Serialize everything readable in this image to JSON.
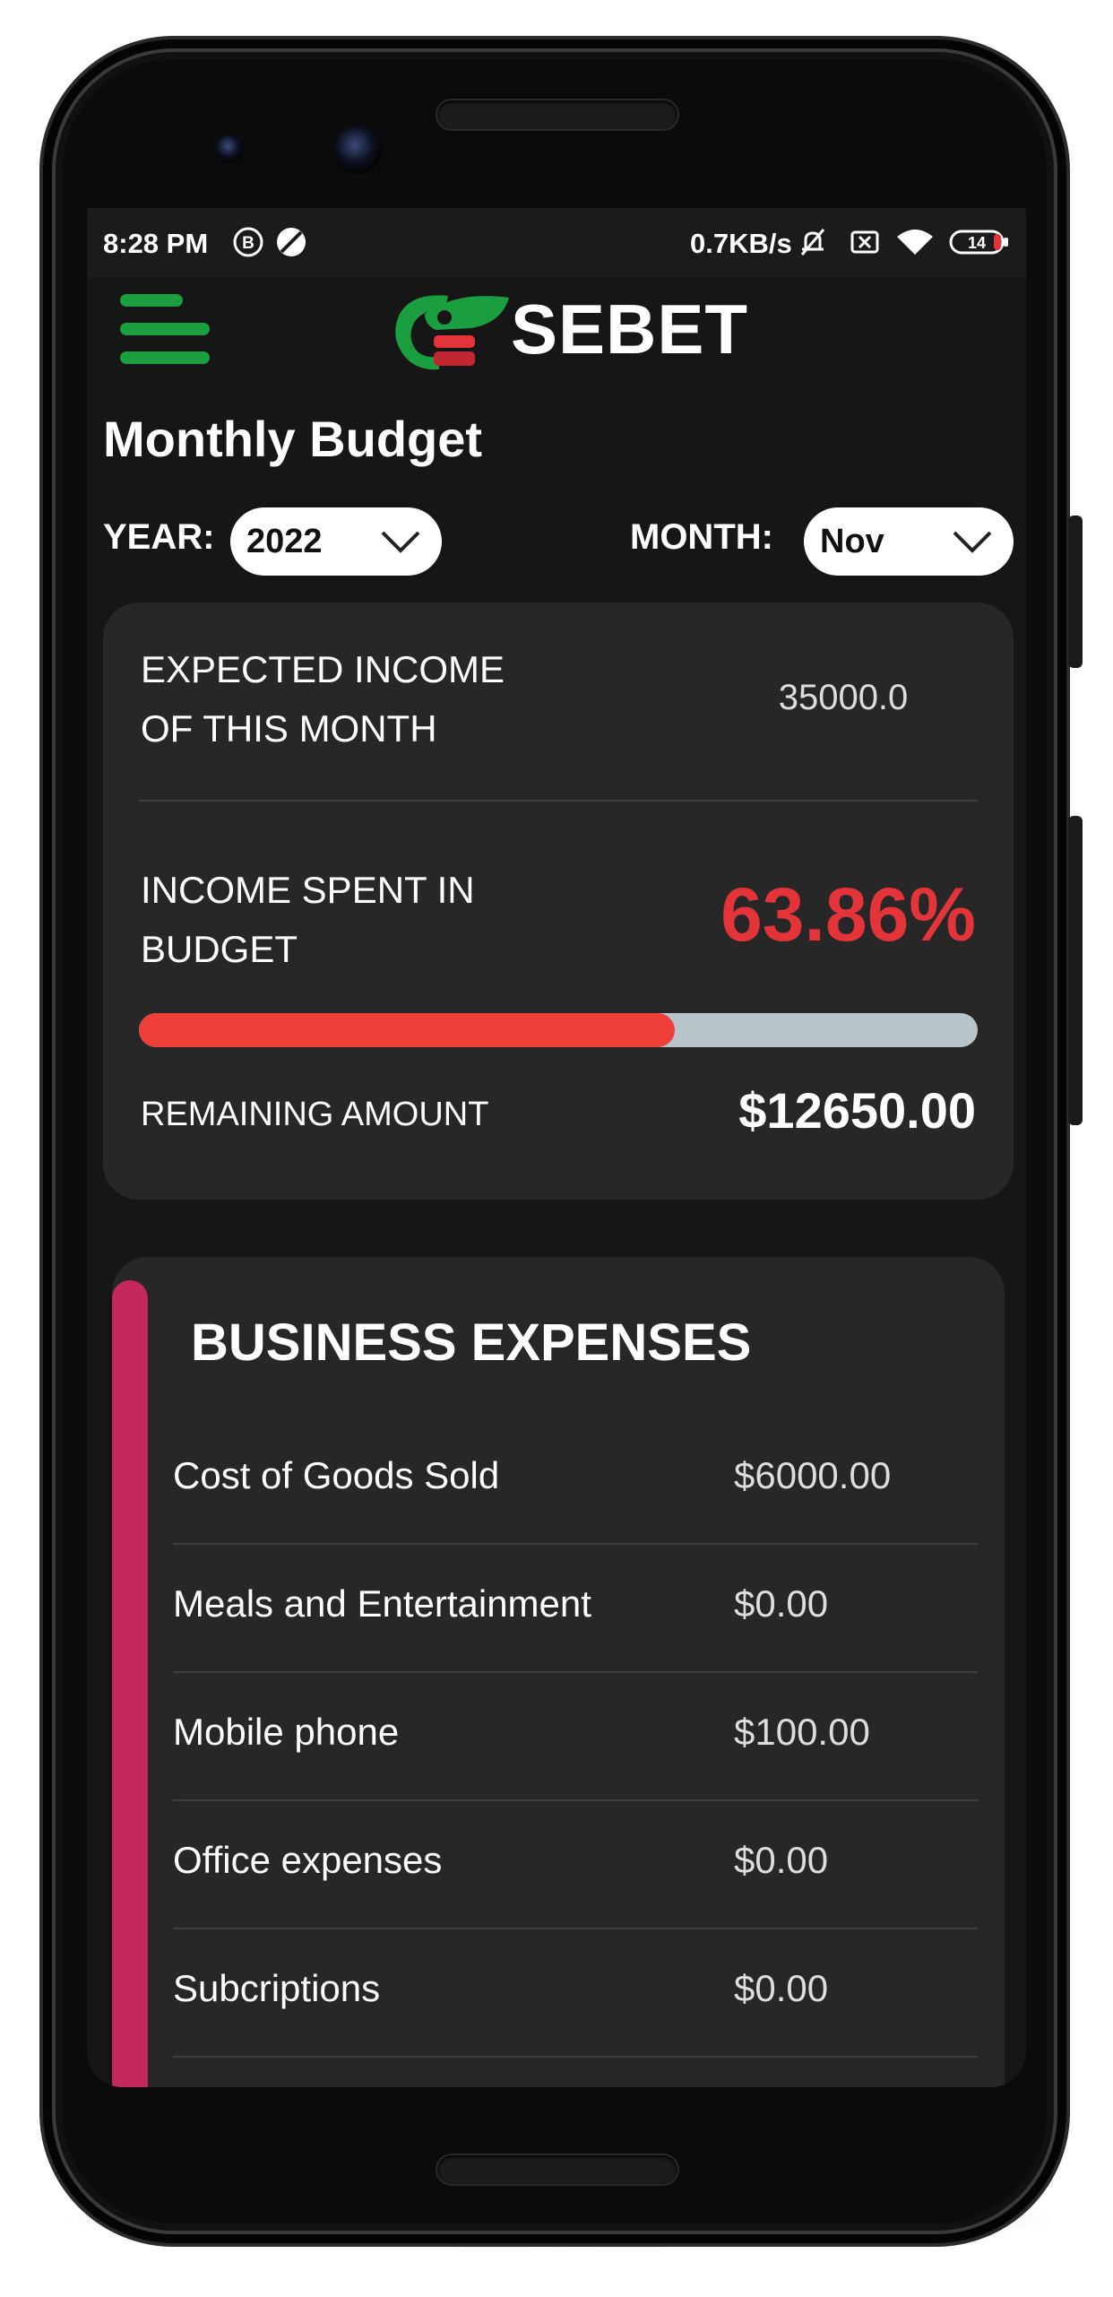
{
  "status_bar": {
    "time": "8:28 PM",
    "network_speed": "0.7KB/s",
    "battery": "14",
    "icons": [
      "b-circle-icon",
      "no-sign-icon",
      "mute-bell-icon",
      "sim-x-icon",
      "wifi-icon",
      "battery-icon"
    ]
  },
  "header": {
    "menu_icon": "hamburger-menu-icon",
    "app_name": "SEBET"
  },
  "page": {
    "title": "Monthly Budget"
  },
  "filters": {
    "year_label": "YEAR:",
    "year_value": "2022",
    "month_label": "MONTH:",
    "month_value": "Nov"
  },
  "budget": {
    "expected_income_line1": "EXPECTED INCOME",
    "expected_income_line2": "OF THIS MONTH",
    "expected_income_value": "35000.0",
    "spent_line1": "INCOME SPENT IN",
    "spent_line2": "BUDGET",
    "spent_percent": "63.86%",
    "spent_fraction": 0.6386,
    "remaining_label": "REMAINING AMOUNT",
    "remaining_value": "$12650.00"
  },
  "expenses": {
    "title": "BUSINESS EXPENSES",
    "accent_color": "#c5295c",
    "items": [
      {
        "name": "Cost of Goods Sold",
        "amount": "$6000.00"
      },
      {
        "name": "Meals and Entertainment",
        "amount": "$0.00"
      },
      {
        "name": "Mobile phone",
        "amount": "$100.00"
      },
      {
        "name": "Office expenses",
        "amount": "$0.00"
      },
      {
        "name": "Subcriptions",
        "amount": "$0.00"
      }
    ]
  },
  "colors": {
    "brand_green": "#1b9e3f",
    "alert_red": "#e3343a",
    "background": "#161616",
    "card": "#272727"
  }
}
